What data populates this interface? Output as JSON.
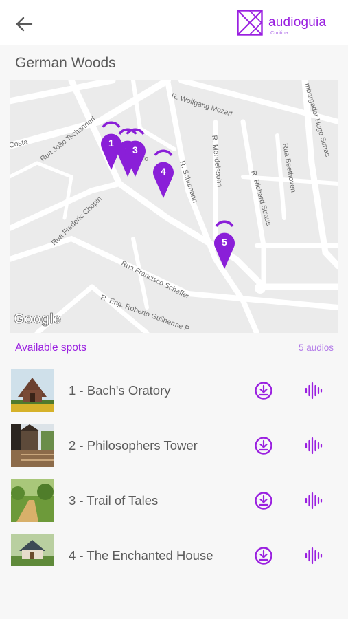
{
  "header": {
    "back_icon": "arrow-left-icon",
    "logo_text": "audioguia",
    "logo_subtext": "Curitiba"
  },
  "page": {
    "title": "German Woods"
  },
  "map": {
    "attribution": "Google",
    "streets": [
      "R. Wolfgang Mozart",
      "Rua João Tschannerl",
      "mbargador Hugo Simas",
      "Costa",
      "R. Mendelssohn",
      "Rua Beethoven",
      "R. Schumann",
      "R. Richard Straus",
      "Rua Frederic Chopin",
      "Rua Francisco Schaffer",
      "R. Eng. Roberto Guilherme P",
      "berto"
    ],
    "markers": [
      "1",
      "2",
      "3",
      "4",
      "5"
    ],
    "marker_color": "#8a1fd8"
  },
  "spots": {
    "header": "Available spots",
    "count": "5 audios",
    "items": [
      {
        "title": "1 - Bach's Oratory"
      },
      {
        "title": "2 - Philosophers Tower"
      },
      {
        "title": "3 - Trail of Tales"
      },
      {
        "title": "4 - The Enchanted House"
      }
    ],
    "download_icon": "download-circle-icon",
    "audio_icon": "audio-wave-icon",
    "accent_color": "#9a20e0"
  }
}
